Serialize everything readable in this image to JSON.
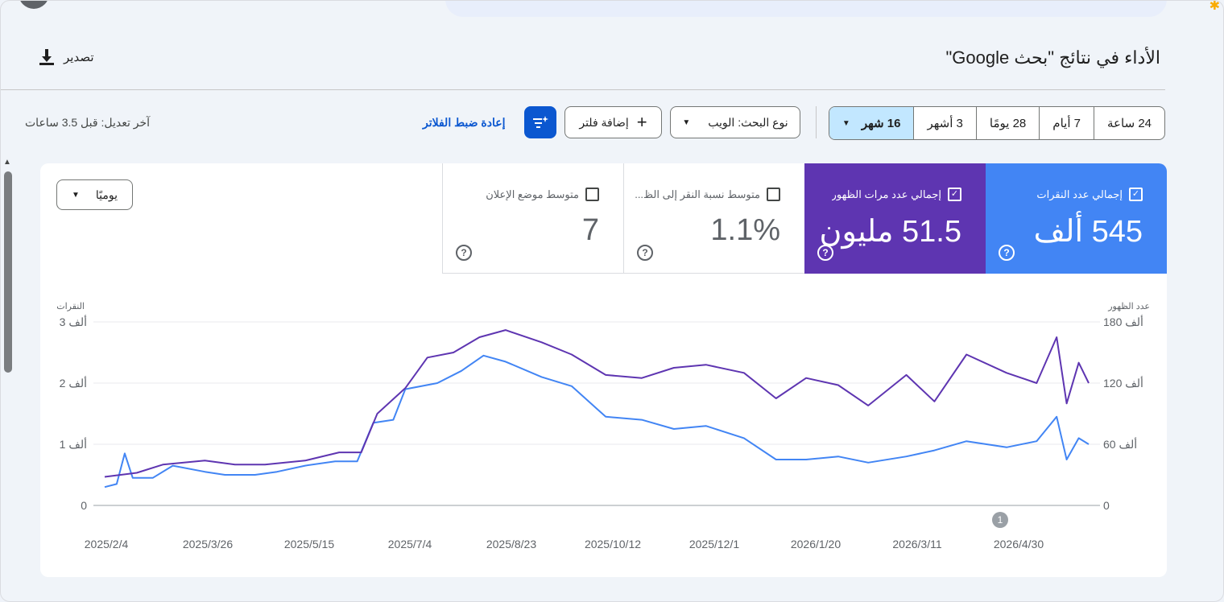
{
  "header": {
    "title": "الأداء في نتائج \"بحث Google\"",
    "export_label": "تصدير"
  },
  "date_ranges": [
    {
      "label": "24 ساعة",
      "selected": false
    },
    {
      "label": "7 أيام",
      "selected": false
    },
    {
      "label": "28 يومًا",
      "selected": false
    },
    {
      "label": "3 أشهر",
      "selected": false
    },
    {
      "label": "16 شهر",
      "selected": true
    }
  ],
  "search_type": {
    "label": "نوع البحث: الويب"
  },
  "add_filter": {
    "label": "إضافة فلتر"
  },
  "reset_filters": "إعادة ضبط الفلاتر",
  "last_edited": "آخر تعديل: قبل 3.5 ساعات",
  "granularity": "يوميًا",
  "metrics": {
    "clicks": {
      "label": "إجمالي عدد النقرات",
      "value": "545 ألف",
      "checked": true,
      "color": "#4285f4"
    },
    "impressions": {
      "label": "إجمالي عدد مرات الظهور",
      "value": "51.5 مليون",
      "checked": true,
      "color": "#5e35b1"
    },
    "ctr": {
      "label": "متوسط نسبة النقر إلى الظ...",
      "value": "1.1%",
      "checked": false
    },
    "position": {
      "label": "متوسط موضع الإعلان",
      "value": "7",
      "checked": false
    }
  },
  "chart_data": {
    "type": "line",
    "left_axis_title": "النقرات",
    "right_axis_title": "عدد الظهور",
    "left_ticks": [
      "0",
      "1 ألف",
      "2 ألف",
      "3 ألف"
    ],
    "right_ticks": [
      "0",
      "60 ألف",
      "120 ألف",
      "180 ألف"
    ],
    "x_labels": [
      "2025/2/4",
      "2025/3/26",
      "2025/5/15",
      "2025/7/4",
      "2025/8/23",
      "2025/10/12",
      "2025/12/1",
      "2026/1/20",
      "2026/3/11",
      "2026/4/30"
    ],
    "annotation": "1",
    "grid": true,
    "series": [
      {
        "name": "إجمالي عدد النقرات",
        "axis": "left",
        "color": "#4285f4",
        "points": [
          [
            "2025-02-04",
            0.3
          ],
          [
            "2025-02-10",
            0.35
          ],
          [
            "2025-02-14",
            0.85
          ],
          [
            "2025-02-18",
            0.45
          ],
          [
            "2025-02-28",
            0.45
          ],
          [
            "2025-03-10",
            0.65
          ],
          [
            "2025-03-26",
            0.55
          ],
          [
            "2025-04-05",
            0.5
          ],
          [
            "2025-04-20",
            0.5
          ],
          [
            "2025-05-01",
            0.55
          ],
          [
            "2025-05-15",
            0.65
          ],
          [
            "2025-05-30",
            0.72
          ],
          [
            "2025-06-10",
            0.72
          ],
          [
            "2025-06-18",
            1.35
          ],
          [
            "2025-06-28",
            1.4
          ],
          [
            "2025-07-04",
            1.9
          ],
          [
            "2025-07-20",
            2.0
          ],
          [
            "2025-08-01",
            2.2
          ],
          [
            "2025-08-12",
            2.45
          ],
          [
            "2025-08-23",
            2.35
          ],
          [
            "2025-09-10",
            2.1
          ],
          [
            "2025-09-25",
            1.95
          ],
          [
            "2025-10-12",
            1.45
          ],
          [
            "2025-10-30",
            1.4
          ],
          [
            "2025-11-15",
            1.25
          ],
          [
            "2025-12-01",
            1.3
          ],
          [
            "2025-12-20",
            1.1
          ],
          [
            "2026-01-05",
            0.75
          ],
          [
            "2026-01-20",
            0.75
          ],
          [
            "2026-02-05",
            0.8
          ],
          [
            "2026-02-20",
            0.7
          ],
          [
            "2026-03-11",
            0.8
          ],
          [
            "2026-03-25",
            0.9
          ],
          [
            "2026-04-10",
            1.05
          ],
          [
            "2026-04-30",
            0.95
          ],
          [
            "2026-05-15",
            1.05
          ],
          [
            "2026-05-25",
            1.45
          ],
          [
            "2026-05-30",
            0.75
          ],
          [
            "2026-06-05",
            1.1
          ],
          [
            "2026-06-10",
            1.0
          ]
        ]
      },
      {
        "name": "إجمالي عدد مرات الظهور",
        "axis": "right",
        "color": "#5e35b1",
        "points": [
          [
            "2025-02-04",
            28
          ],
          [
            "2025-02-20",
            32
          ],
          [
            "2025-03-05",
            40
          ],
          [
            "2025-03-26",
            44
          ],
          [
            "2025-04-10",
            40
          ],
          [
            "2025-04-25",
            40
          ],
          [
            "2025-05-15",
            44
          ],
          [
            "2025-06-01",
            52
          ],
          [
            "2025-06-12",
            52
          ],
          [
            "2025-06-20",
            90
          ],
          [
            "2025-07-04",
            115
          ],
          [
            "2025-07-15",
            145
          ],
          [
            "2025-07-28",
            150
          ],
          [
            "2025-08-10",
            165
          ],
          [
            "2025-08-23",
            172
          ],
          [
            "2025-09-10",
            160
          ],
          [
            "2025-09-25",
            148
          ],
          [
            "2025-10-12",
            128
          ],
          [
            "2025-10-30",
            125
          ],
          [
            "2025-11-15",
            135
          ],
          [
            "2025-12-01",
            138
          ],
          [
            "2025-12-20",
            130
          ],
          [
            "2026-01-05",
            105
          ],
          [
            "2026-01-20",
            125
          ],
          [
            "2026-02-05",
            118
          ],
          [
            "2026-02-20",
            98
          ],
          [
            "2026-03-11",
            128
          ],
          [
            "2026-03-25",
            102
          ],
          [
            "2026-04-10",
            148
          ],
          [
            "2026-04-30",
            130
          ],
          [
            "2026-05-15",
            120
          ],
          [
            "2026-05-25",
            165
          ],
          [
            "2026-05-30",
            100
          ],
          [
            "2026-06-05",
            140
          ],
          [
            "2026-06-10",
            120
          ]
        ]
      }
    ]
  }
}
